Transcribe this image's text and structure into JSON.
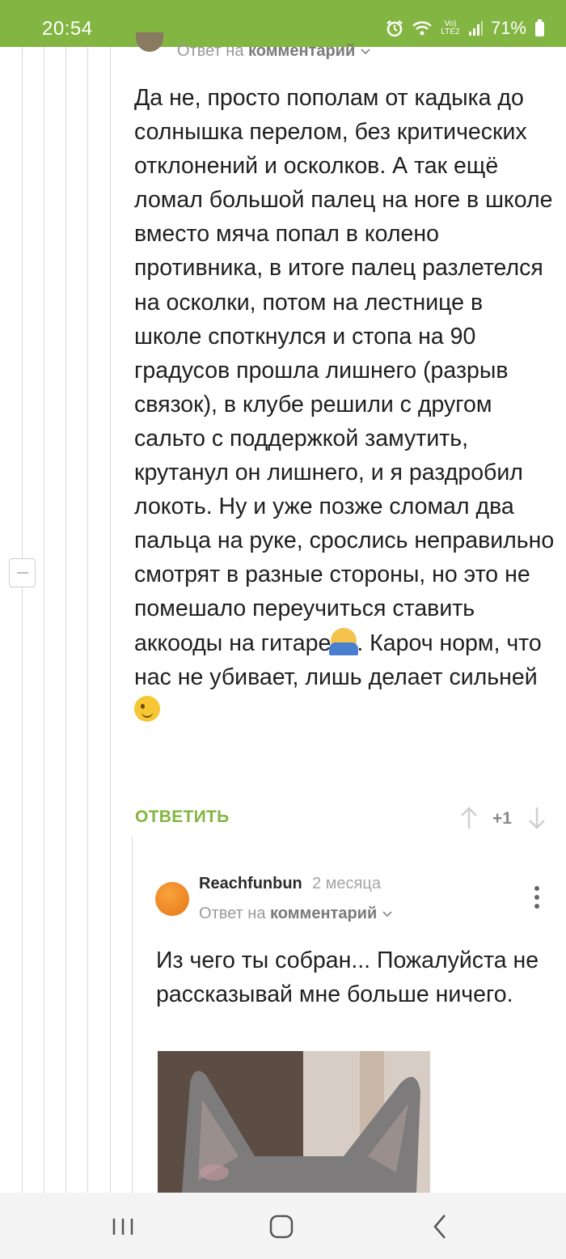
{
  "status_bar": {
    "time": "20:54",
    "battery": "71%",
    "network": "Vo) LTE2",
    "icons": [
      "alarm-icon",
      "wifi-icon",
      "volte-icon",
      "signal-icon",
      "battery-icon"
    ],
    "color": "#82b542"
  },
  "parent_comment": {
    "reply_prefix": "Ответ на",
    "reply_link": "комментарий",
    "text": "Да не, просто пополам от кадыка до солнышка перелом, без критических отклонений и осколков. А так ещё ломал большой палец на ноге в школе вместо мяча попал в колено противника, в итоге палец разлетелся на осколки, потом на лестнице в школе споткнулся и стопа на 90 градусов прошла лишнего (разрыв связок), в клубе решили с другом сальто с поддержкой замутить, крутанул он лишнего, и я раздробил локоть. Ну и уже позже сломал два пальца на руке, срослись неправильно смотрят в разные стороны, но это не помешало переучиться ставить аккооды на гитаре",
    "text_after_shrug": ". Кароч норм, что нас не убивает, лишь делает сильней",
    "reply_button": "ОТВЕТИТЬ",
    "rating": "+1"
  },
  "reply_comment": {
    "author": "Reachfunbun",
    "date": "2 месяца",
    "reply_prefix": "Ответ на",
    "reply_link": "комментарий",
    "text": "Из чего ты собран... Пожалуйста не рассказывай мне больше ничего."
  },
  "colors": {
    "accent": "#82b542",
    "avatar": "#ef8a25"
  }
}
